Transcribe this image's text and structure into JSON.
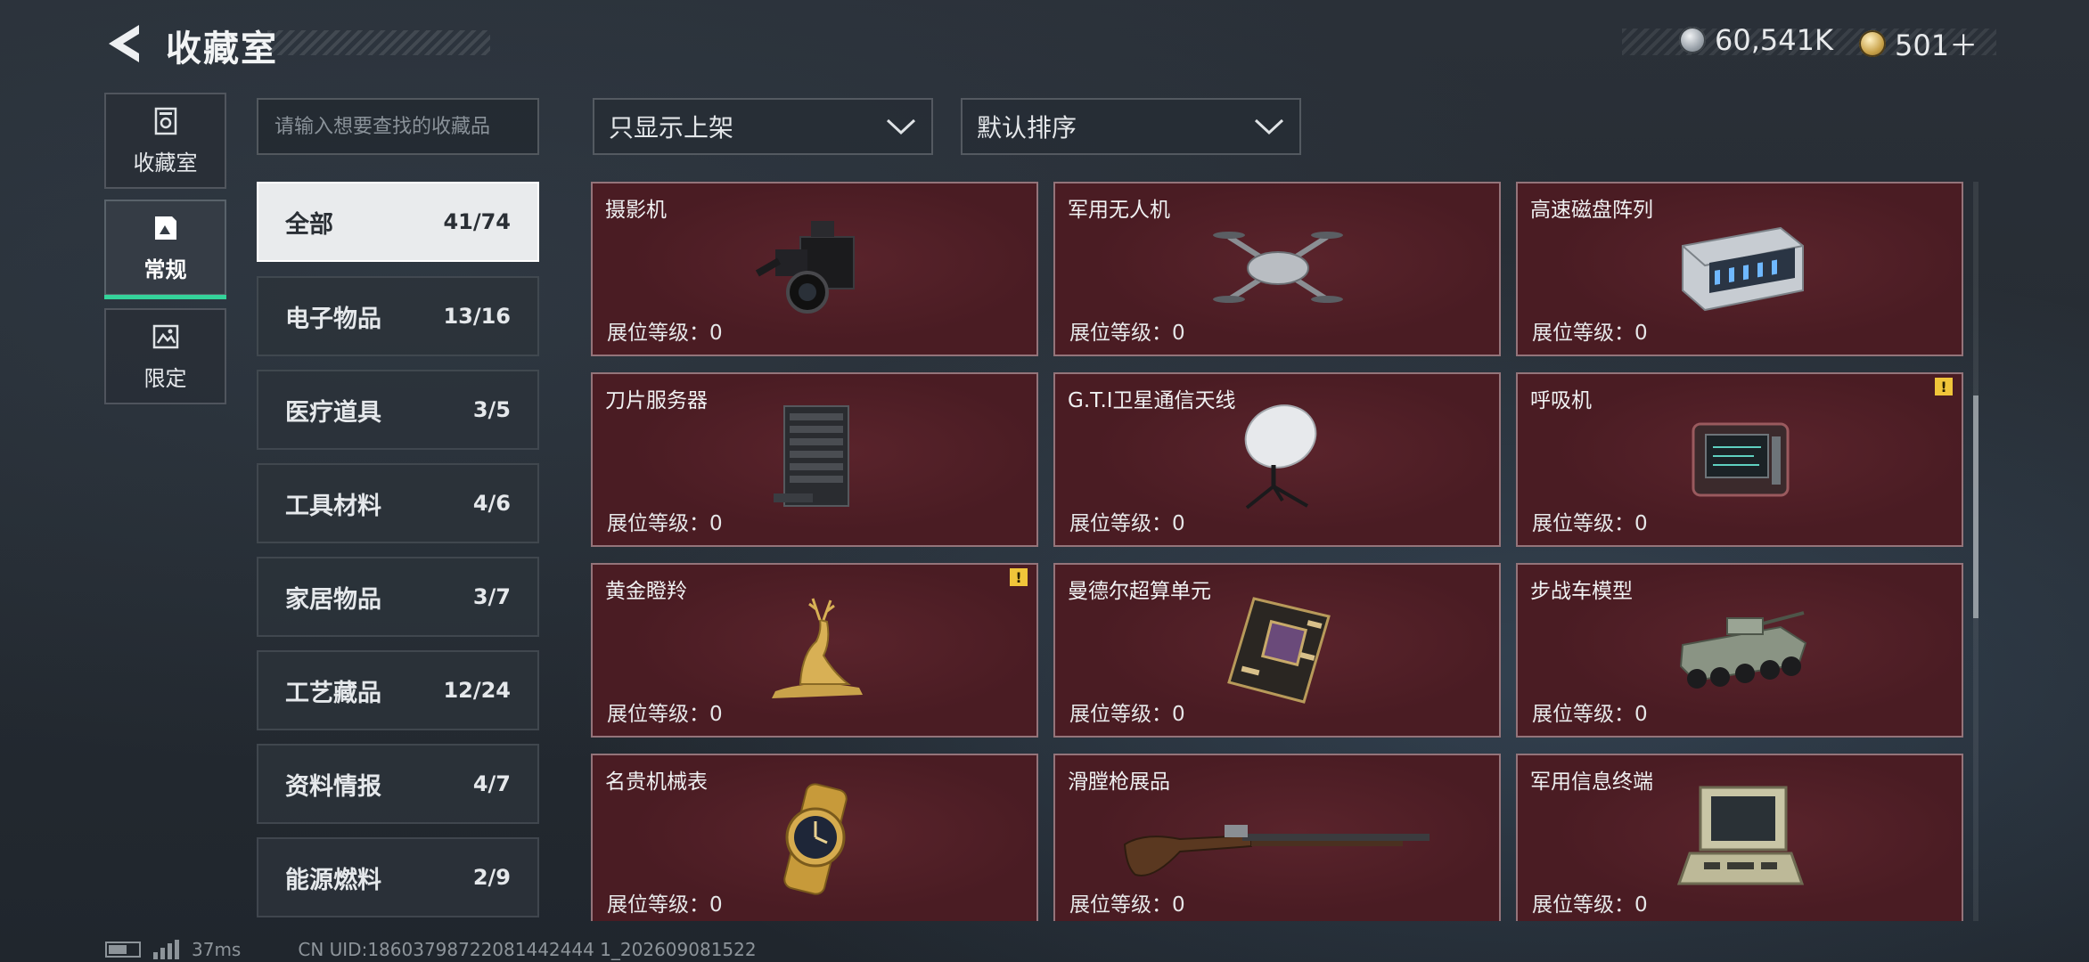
{
  "header": {
    "title": "收藏室",
    "currencies": [
      {
        "name": "silver-coin-icon",
        "value": "60,541K"
      },
      {
        "name": "gold-coin-icon",
        "value": "501＋"
      }
    ]
  },
  "mode_tabs": [
    {
      "label": "收藏室",
      "icon": "vault-icon",
      "active": false
    },
    {
      "label": "常规",
      "icon": "gallery-icon",
      "active": true
    },
    {
      "label": "限定",
      "icon": "limited-icon",
      "active": false
    }
  ],
  "search": {
    "placeholder": "请输入想要查找的收藏品",
    "value": ""
  },
  "categories": [
    {
      "label": "全部",
      "count": "41/74",
      "active": true
    },
    {
      "label": "电子物品",
      "count": "13/16"
    },
    {
      "label": "医疗道具",
      "count": "3/5"
    },
    {
      "label": "工具材料",
      "count": "4/6"
    },
    {
      "label": "家居物品",
      "count": "3/7"
    },
    {
      "label": "工艺藏品",
      "count": "12/24"
    },
    {
      "label": "资料情报",
      "count": "4/7"
    },
    {
      "label": "能源燃料",
      "count": "2/9"
    }
  ],
  "filters": {
    "display_filter": "只显示上架",
    "sort_order": "默认排序"
  },
  "level_label": "展位等级：",
  "items": [
    {
      "name": "摄影机",
      "level": "0",
      "icon": "camera-icon",
      "alert": false
    },
    {
      "name": "军用无人机",
      "level": "0",
      "icon": "drone-icon",
      "alert": false
    },
    {
      "name": "高速磁盘阵列",
      "level": "0",
      "icon": "disk-array-icon",
      "alert": false
    },
    {
      "name": "刀片服务器",
      "level": "0",
      "icon": "blade-server-icon",
      "alert": false
    },
    {
      "name": "G.T.I卫星通信天线",
      "level": "0",
      "icon": "satellite-dish-icon",
      "alert": false
    },
    {
      "name": "呼吸机",
      "level": "0",
      "icon": "ventilator-icon",
      "alert": true
    },
    {
      "name": "黄金瞪羚",
      "level": "0",
      "icon": "golden-gazelle-icon",
      "alert": true
    },
    {
      "name": "曼德尔超算单元",
      "level": "0",
      "icon": "supercomputer-unit-icon",
      "alert": false
    },
    {
      "name": "步战车模型",
      "level": "0",
      "icon": "ifv-model-icon",
      "alert": false
    },
    {
      "name": "名贵机械表",
      "level": "0",
      "icon": "watch-icon",
      "alert": false
    },
    {
      "name": "滑膛枪展品",
      "level": "0",
      "icon": "musket-icon",
      "alert": false
    },
    {
      "name": "军用信息终端",
      "level": "0",
      "icon": "terminal-case-icon",
      "alert": false
    }
  ],
  "footer": {
    "ping": "37ms",
    "uid": "CN UID:18603798722081442444 1_202609081522"
  },
  "colors": {
    "card_bg": "#4a1c23",
    "active_tab_underline": "#34d39a",
    "alert": "#f0c53a"
  }
}
